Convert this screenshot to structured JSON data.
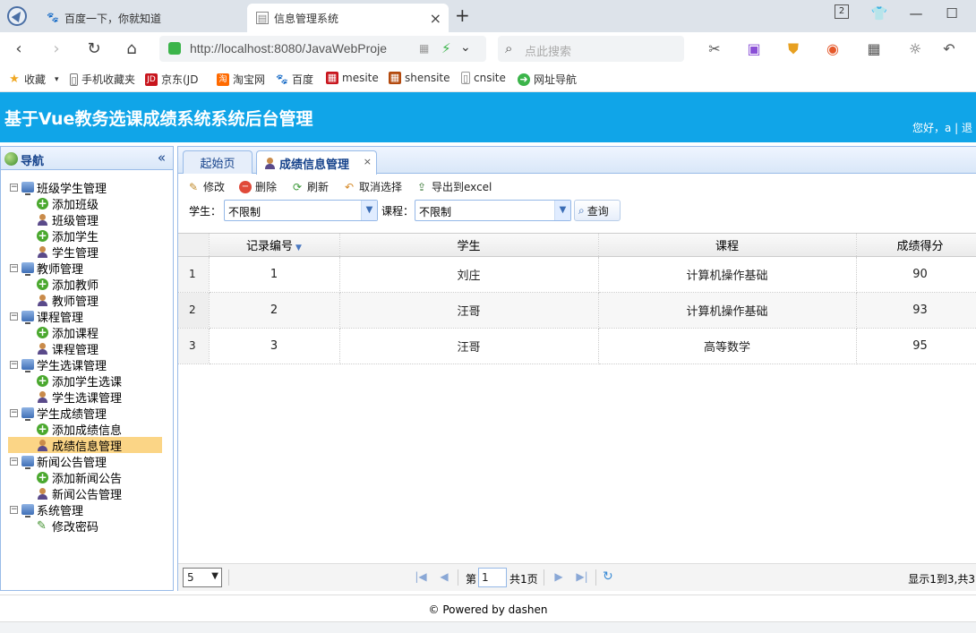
{
  "browser": {
    "tabs": [
      {
        "title": "百度一下，你就知道",
        "icon": "baidu-paw-icon"
      },
      {
        "title": "信息管理系统",
        "icon": "page-icon",
        "close": "×"
      }
    ],
    "new_tab": "+",
    "tab_count": "2",
    "window_controls": {
      "minimize": "—",
      "maximize": "☐",
      "close": "✕"
    },
    "url": "http://localhost:8080/JavaWebProje",
    "search_placeholder": "点此搜索",
    "bookmarks": [
      "收藏",
      "手机收藏夹",
      "京东(JD",
      "淘宝网",
      "百度",
      "mesite",
      "shensite",
      "cnsite",
      "网址导航"
    ]
  },
  "app": {
    "title": "基于Vue教务选课成绩系统系统后台管理",
    "greeting": "您好，a | 退"
  },
  "nav": {
    "title": "导航",
    "collapse": "«",
    "groups": [
      {
        "label": "班级学生管理",
        "items": [
          {
            "label": "添加班级",
            "icon": "add"
          },
          {
            "label": "班级管理",
            "icon": "user"
          },
          {
            "label": "添加学生",
            "icon": "add"
          },
          {
            "label": "学生管理",
            "icon": "user"
          }
        ]
      },
      {
        "label": "教师管理",
        "items": [
          {
            "label": "添加教师",
            "icon": "add"
          },
          {
            "label": "教师管理",
            "icon": "user"
          }
        ]
      },
      {
        "label": "课程管理",
        "items": [
          {
            "label": "添加课程",
            "icon": "add"
          },
          {
            "label": "课程管理",
            "icon": "user"
          }
        ]
      },
      {
        "label": "学生选课管理",
        "items": [
          {
            "label": "添加学生选课",
            "icon": "add"
          },
          {
            "label": "学生选课管理",
            "icon": "user"
          }
        ]
      },
      {
        "label": "学生成绩管理",
        "items": [
          {
            "label": "添加成绩信息",
            "icon": "add"
          },
          {
            "label": "成绩信息管理",
            "icon": "user",
            "selected": true
          }
        ]
      },
      {
        "label": "新闻公告管理",
        "items": [
          {
            "label": "添加新闻公告",
            "icon": "add"
          },
          {
            "label": "新闻公告管理",
            "icon": "user"
          }
        ]
      },
      {
        "label": "系统管理",
        "items": [
          {
            "label": "修改密码",
            "icon": "pencil"
          }
        ]
      }
    ]
  },
  "content": {
    "tabs": [
      {
        "label": "起始页"
      },
      {
        "label": "成绩信息管理",
        "close": "×"
      }
    ],
    "toolbar": {
      "edit": "修改",
      "delete": "删除",
      "refresh": "刷新",
      "cancel_select": "取消选择",
      "export": "导出到excel"
    },
    "filter": {
      "student_label": "学生：",
      "student_value": "不限制",
      "course_label": "课程：",
      "course_value": "不限制",
      "query": "查询"
    },
    "grid": {
      "columns": [
        "记录编号",
        "学生",
        "课程",
        "成绩得分"
      ],
      "rows": [
        {
          "rownum": "1",
          "id": "1",
          "student": "刘庄",
          "course": "计算机操作基础",
          "score": "90"
        },
        {
          "rownum": "2",
          "id": "2",
          "student": "汪哥",
          "course": "计算机操作基础",
          "score": "93"
        },
        {
          "rownum": "3",
          "id": "3",
          "student": "汪哥",
          "course": "高等数学",
          "score": "95"
        }
      ]
    },
    "pager": {
      "page_size": "5",
      "page_prefix": "第",
      "page_value": "1",
      "page_total": "共1页",
      "info": "显示1到3,共3"
    }
  },
  "footer": {
    "text": "© Powered by dashen"
  }
}
